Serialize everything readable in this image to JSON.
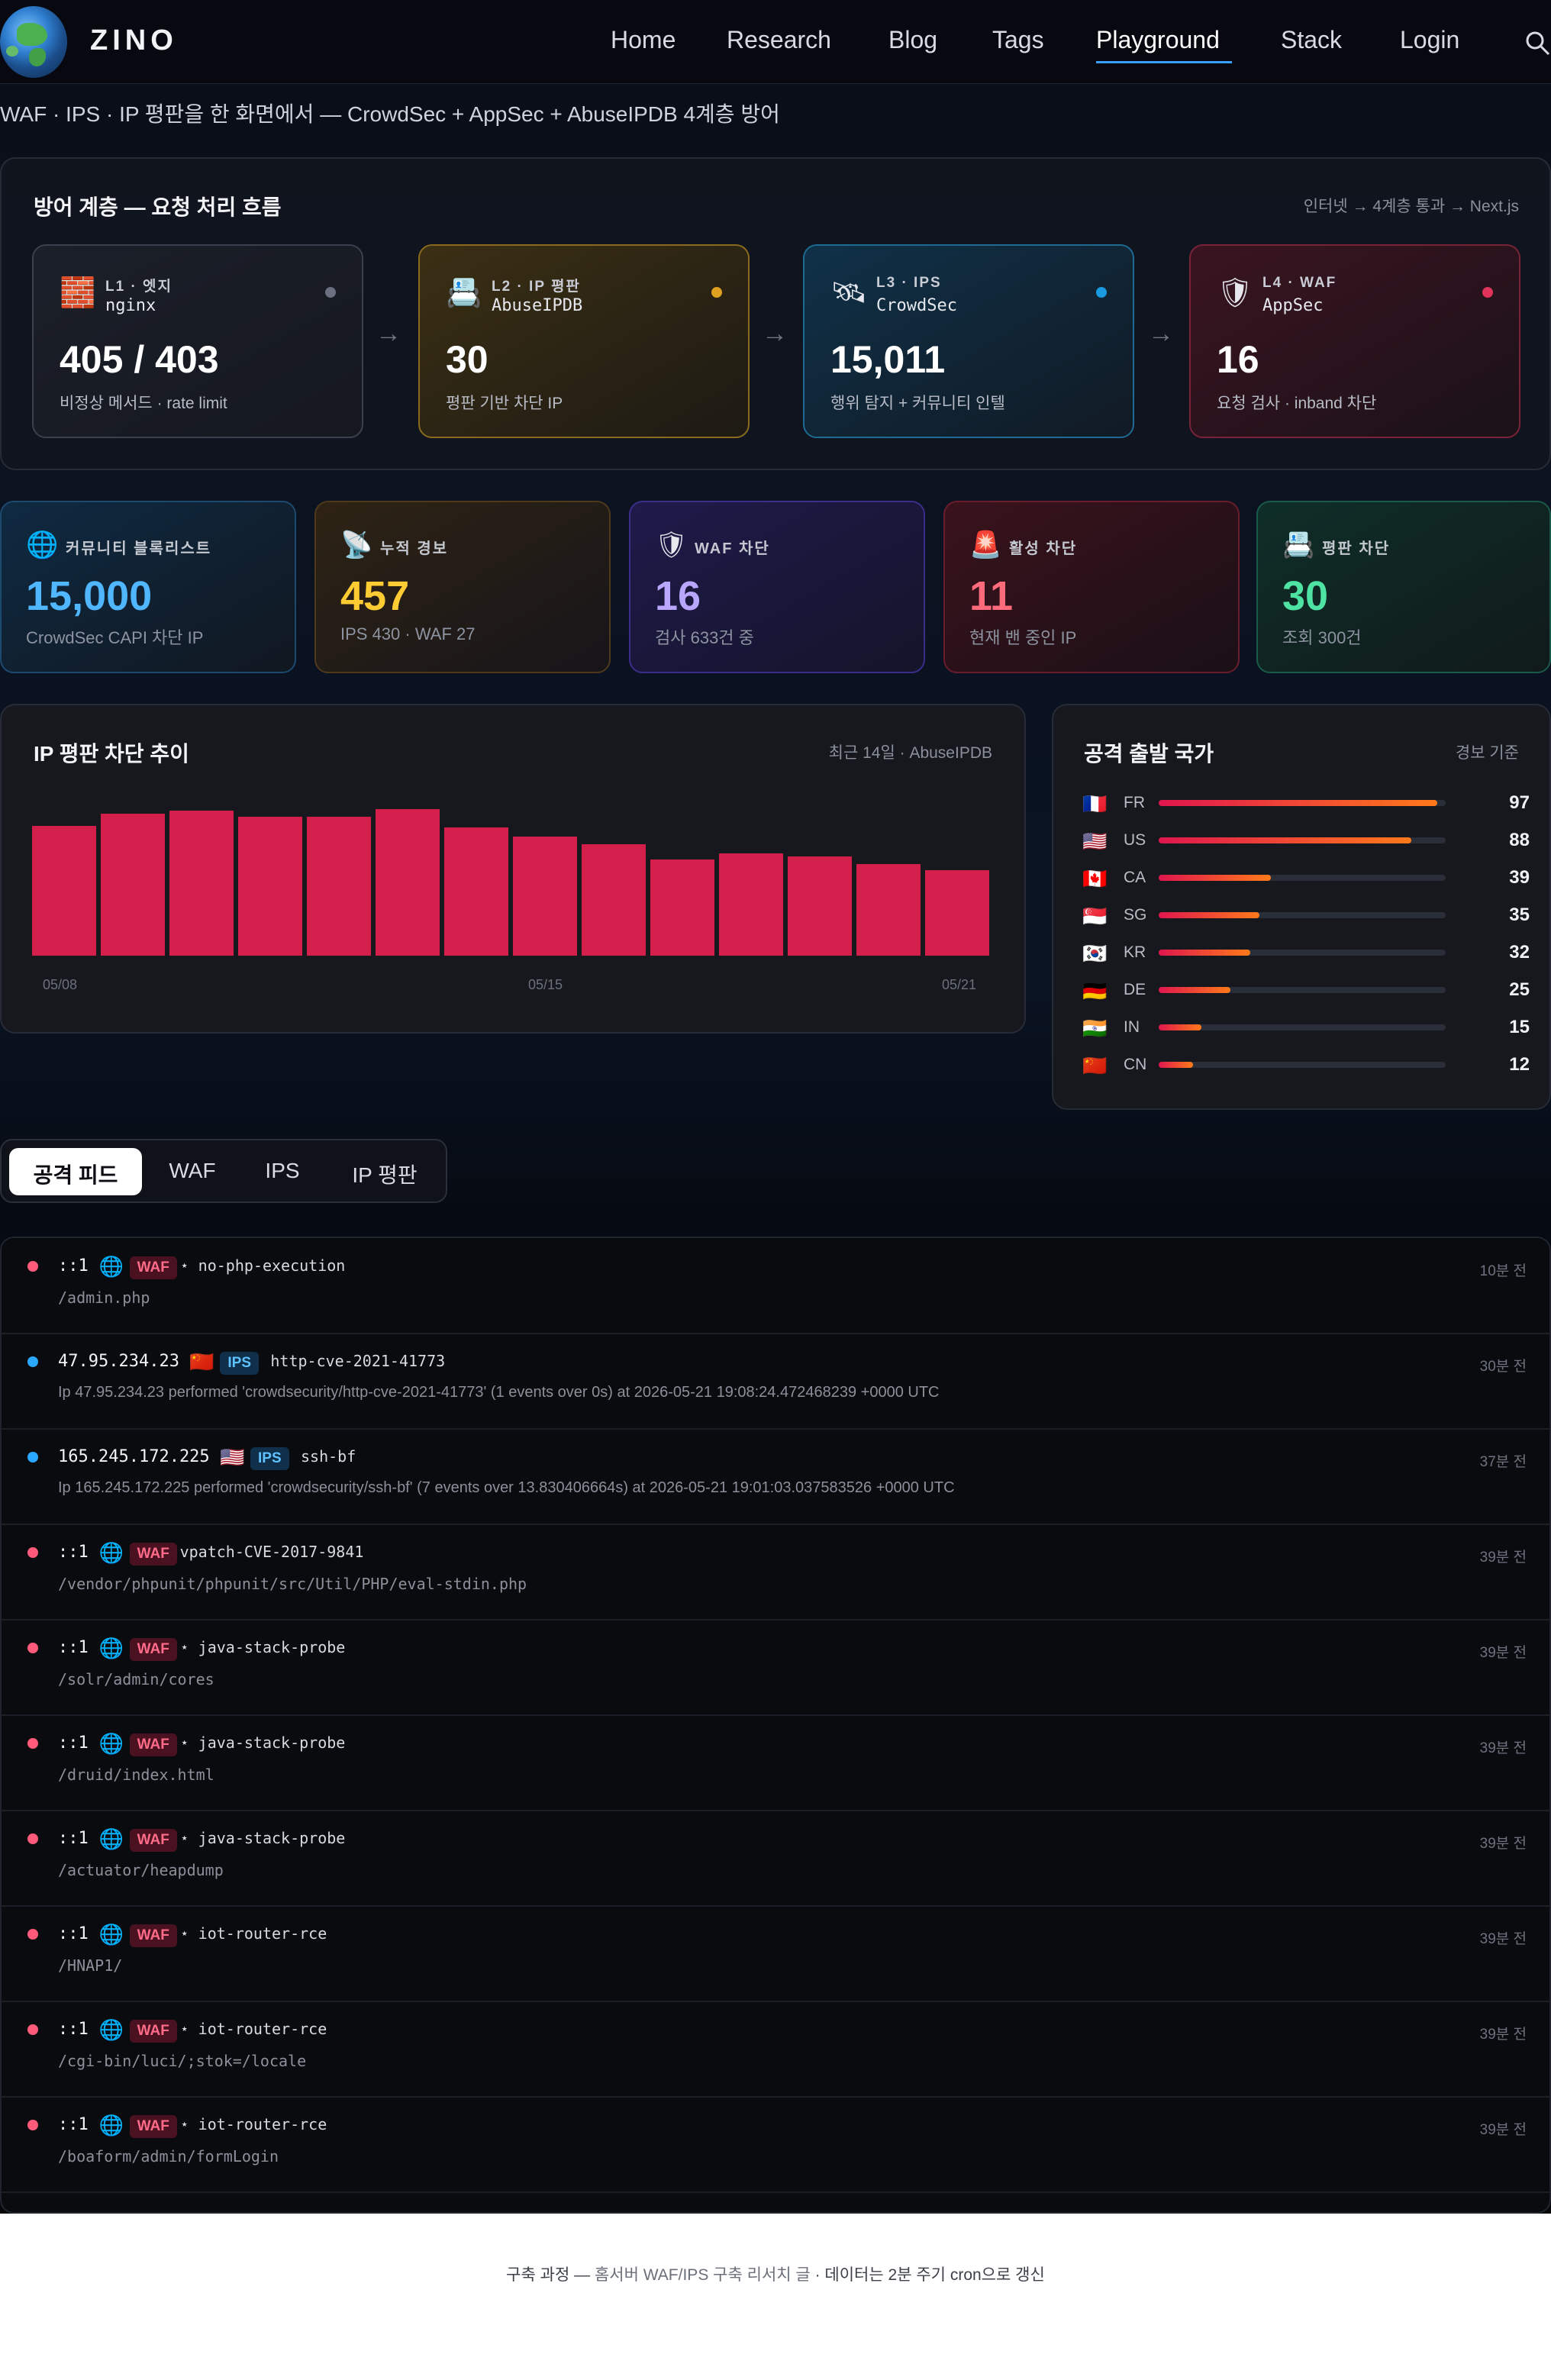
{
  "nav": {
    "brand": "ZINO",
    "links": [
      "Home",
      "Research",
      "Blog",
      "Tags",
      "Playground",
      "Stack",
      "Login"
    ]
  },
  "subtitle": "WAF · IPS · IP 평판을 한 화면에서 — CrowdSec + AppSec + AbuseIPDB 4계층 방어",
  "flow": {
    "title": "방어 계층 — 요청 처리 흐름",
    "note": "인터넷 → 4계층 통과 → Next.js",
    "layers": [
      {
        "tag": "L1 · 엣지",
        "name": "nginx",
        "value": "405 / 403",
        "desc": "비정상 메서드 · rate limit",
        "icon": "brick-wall-icon",
        "glyph": "🧱"
      },
      {
        "tag": "L2 · IP 평판",
        "name": "AbuseIPDB",
        "value": "30",
        "desc": "평판 기반 차단 IP",
        "icon": "printer-icon",
        "glyph": "📇"
      },
      {
        "tag": "L3 · IPS",
        "name": "CrowdSec",
        "value": "15,011",
        "desc": "행위 탐지 + 커뮤니티 인텔",
        "icon": "satellite-icon",
        "glyph": "🛰"
      },
      {
        "tag": "L4 · WAF",
        "name": "AppSec",
        "value": "16",
        "desc": "요청 검사 · inband 차단",
        "icon": "shield-icon",
        "glyph": "🛡"
      }
    ]
  },
  "stats": [
    {
      "label": "커뮤니티 블록리스트",
      "value": "15,000",
      "desc": "CrowdSec CAPI 차단 IP",
      "icon": "globe-icon",
      "glyph": "🌐",
      "color": "#4fb6ff"
    },
    {
      "label": "누적 경보",
      "value": "457",
      "desc": "IPS 430 · WAF 27",
      "icon": "satellite-dish-icon",
      "glyph": "📡",
      "color": "#ffcc33"
    },
    {
      "label": "WAF 차단",
      "value": "16",
      "desc": "검사 633건 중",
      "icon": "shield-icon",
      "glyph": "🛡",
      "color": "#b9a6ff"
    },
    {
      "label": "활성 차단",
      "value": "11",
      "desc": "현재 밴 중인 IP",
      "icon": "siren-icon",
      "glyph": "🚨",
      "color": "#ff6b7a"
    },
    {
      "label": "평판 차단",
      "value": "30",
      "desc": "조회 300건",
      "icon": "printer-icon",
      "glyph": "📇",
      "color": "#4fe3a3"
    }
  ],
  "trend": {
    "title": "IP 평판 차단 추이",
    "note": "최근 14일 · AbuseIPDB",
    "tick_labels": [
      "05/08",
      "05/15",
      "05/21"
    ]
  },
  "chart_data": {
    "type": "bar",
    "categories": [
      "05/08",
      "05/09",
      "05/10",
      "05/11",
      "05/12",
      "05/13",
      "05/14",
      "05/15",
      "05/16",
      "05/17",
      "05/18",
      "05/19",
      "05/20",
      "05/21"
    ],
    "values": [
      85,
      93,
      95,
      91,
      91,
      96,
      84,
      78,
      73,
      63,
      67,
      65,
      60,
      56
    ],
    "ylim": [
      0,
      100
    ],
    "grid": false,
    "color": "#d41f4c"
  },
  "countries": {
    "title": "공격 출발 국가",
    "note": "경보 기준",
    "items": [
      {
        "flag": "🇫🇷",
        "code": "FR",
        "count": 97
      },
      {
        "flag": "🇺🇸",
        "code": "US",
        "count": 88
      },
      {
        "flag": "🇨🇦",
        "code": "CA",
        "count": 39
      },
      {
        "flag": "🇸🇬",
        "code": "SG",
        "count": 35
      },
      {
        "flag": "🇰🇷",
        "code": "KR",
        "count": 32
      },
      {
        "flag": "🇩🇪",
        "code": "DE",
        "count": 25
      },
      {
        "flag": "🇮🇳",
        "code": "IN",
        "count": 15
      },
      {
        "flag": "🇨🇳",
        "code": "CN",
        "count": 12
      }
    ]
  },
  "tabs": [
    "공격 피드",
    "WAF",
    "IPS",
    "IP 평판"
  ],
  "feed": [
    {
      "kind": "WAF",
      "ip": "::1",
      "flag": "globe",
      "rule": "⋆ no-php-execution",
      "detail": "/admin.php",
      "time": "10분 전"
    },
    {
      "kind": "IPS",
      "ip": "47.95.234.23",
      "flag": "🇨🇳",
      "rule": "http-cve-2021-41773",
      "detail": "Ip 47.95.234.23 performed 'crowdsecurity/http-cve-2021-41773' (1 events over 0s) at 2026-05-21 19:08:24.472468239 +0000 UTC",
      "time": "30분 전"
    },
    {
      "kind": "IPS",
      "ip": "165.245.172.225",
      "flag": "🇺🇸",
      "rule": "ssh-bf",
      "detail": "Ip 165.245.172.225 performed 'crowdsecurity/ssh-bf' (7 events over 13.830406664s) at 2026-05-21 19:01:03.037583526 +0000 UTC",
      "time": "37분 전"
    },
    {
      "kind": "WAF",
      "ip": "::1",
      "flag": "globe",
      "rule": "vpatch-CVE-2017-9841",
      "detail": "/vendor/phpunit/phpunit/src/Util/PHP/eval-stdin.php",
      "time": "39분 전"
    },
    {
      "kind": "WAF",
      "ip": "::1",
      "flag": "globe",
      "rule": "⋆ java-stack-probe",
      "detail": "/solr/admin/cores",
      "time": "39분 전"
    },
    {
      "kind": "WAF",
      "ip": "::1",
      "flag": "globe",
      "rule": "⋆ java-stack-probe",
      "detail": "/druid/index.html",
      "time": "39분 전"
    },
    {
      "kind": "WAF",
      "ip": "::1",
      "flag": "globe",
      "rule": "⋆ java-stack-probe",
      "detail": "/actuator/heapdump",
      "time": "39분 전"
    },
    {
      "kind": "WAF",
      "ip": "::1",
      "flag": "globe",
      "rule": "⋆ iot-router-rce",
      "detail": "/HNAP1/",
      "time": "39분 전"
    },
    {
      "kind": "WAF",
      "ip": "::1",
      "flag": "globe",
      "rule": "⋆ iot-router-rce",
      "detail": "/cgi-bin/luci/;stok=/locale",
      "time": "39분 전"
    },
    {
      "kind": "WAF",
      "ip": "::1",
      "flag": "globe",
      "rule": "⋆ iot-router-rce",
      "detail": "/boaform/admin/formLogin",
      "time": "39분 전"
    }
  ],
  "footer": {
    "prefix": "구축 과정 — ",
    "link": "홈서버 WAF/IPS 구축 리서치 글",
    "suffix": " · 데이터는 2분 주기 cron으로 갱신"
  }
}
